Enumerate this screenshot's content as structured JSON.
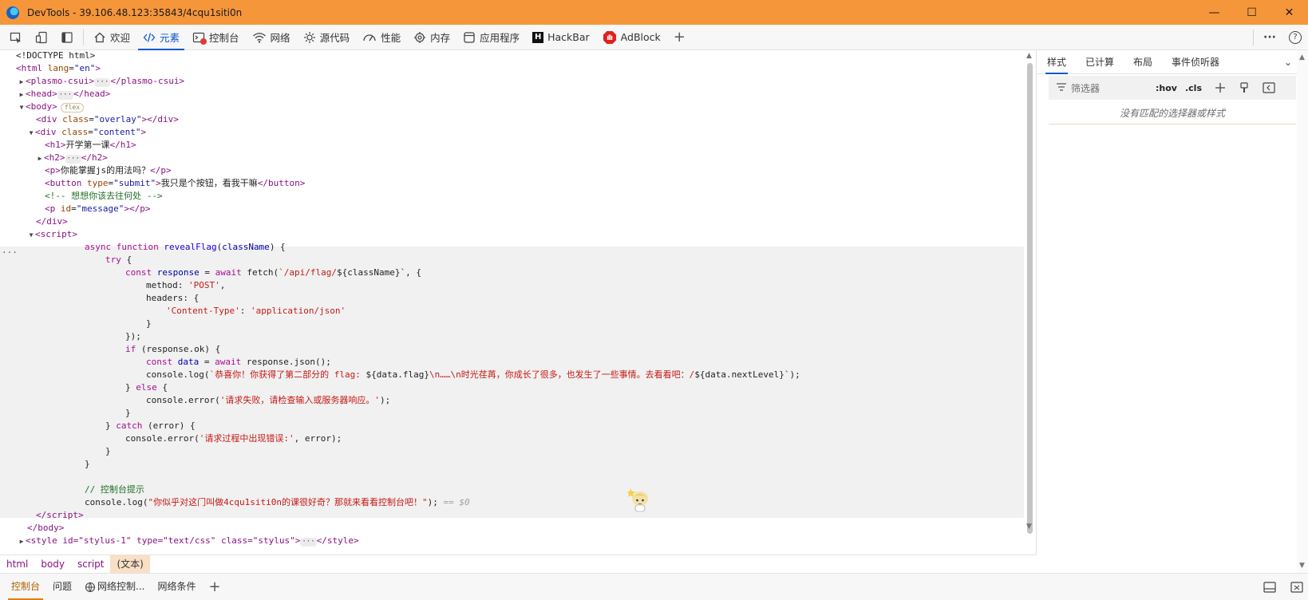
{
  "window": {
    "title": "DevTools - 39.106.48.123:35843/4cqu1siti0n",
    "controls": {
      "minimize": "—",
      "maximize": "☐",
      "close": "✕"
    }
  },
  "toolbar": {
    "tabs": [
      {
        "label": "欢迎",
        "icon": "home-icon"
      },
      {
        "label": "元素",
        "icon": "code-icon",
        "active": true
      },
      {
        "label": "控制台",
        "icon": "console-icon"
      },
      {
        "label": "网络",
        "icon": "wifi-icon"
      },
      {
        "label": "源代码",
        "icon": "gear-source-icon"
      },
      {
        "label": "性能",
        "icon": "performance-icon"
      },
      {
        "label": "内存",
        "icon": "memory-icon"
      },
      {
        "label": "应用程序",
        "icon": "application-icon"
      },
      {
        "label": "HackBar",
        "icon": "hackbar-icon"
      },
      {
        "label": "AdBlock",
        "icon": "adblock-icon"
      }
    ],
    "add_tab": "+",
    "more": "···",
    "help": "?"
  },
  "dom": {
    "doctype": "<!DOCTYPE html>",
    "html_open": "<html",
    "html_lang_attr": "lang",
    "html_lang_val": "\"en\"",
    "plasmo": "plasmo-csui",
    "head": "head",
    "body": "body",
    "flex_badge": "flex",
    "overlay_div_class": "\"overlay\"",
    "content_div_class": "\"content\"",
    "h1_text": "开学第一课",
    "p_text": "你能掌握js的用法吗？",
    "button_type": "\"submit\"",
    "button_text": "我只是个按钮，看我干嘛",
    "comment": "<!-- 想想你该去往何处 -->",
    "message_id": "\"message\"",
    "script": "script",
    "style_partial": "<style id=\"stylus-1\" type=\"text/css\" class=\"stylus\">",
    "ellipsis": "···"
  },
  "script_code": {
    "l1_kw": "async function",
    "l1_fn": "revealFlag",
    "l1_param": "className",
    "l2_kw": "try",
    "l3_const": "const",
    "l3_var": "response",
    "l3_await": "await",
    "l3_fetch": "fetch(",
    "l3_tpl": "`/api/flag/",
    "l3_expr": "${className}",
    "l3_end": "`, {",
    "l4_key": "method:",
    "l4_val": "'POST'",
    "l5_key": "headers: {",
    "l6_key": "'Content-Type'",
    "l6_val": "'application/json'",
    "l9_if": "if",
    "l9_cond": "(response.ok) {",
    "l10_var": "data",
    "l10_rest": "response.json();",
    "l11_call": "console.log(",
    "l11_str1": "`恭喜你！你获得了第二部分的 flag: ",
    "l11_expr1": "${data.flag}",
    "l11_str2": "\\n……\\n时光荏苒，你成长了很多，也发生了一些事情。去看看吧：/",
    "l11_expr2": "${data.nextLevel}",
    "l11_end": "`);",
    "l12_else": "else",
    "l13_call": "console.error(",
    "l13_str": "'请求失败，请检查输入或服务器响应。'",
    "l16_catch": "catch",
    "l16_param": "(error) {",
    "l17_call": "console.error(",
    "l17_str": "'请求过程中出现错误:'",
    "l17_end": ", error);",
    "l21_cmt": "// 控制台提示",
    "l22_call": "console.log(",
    "l22_str": "\"你似乎对这门叫做4cqu1siti0n的课很好奇？那就来看看控制台吧！\"",
    "l22_end": ");",
    "l22_dollar0": "== $0"
  },
  "breadcrumb": [
    "html",
    "body",
    "script",
    "(文本)"
  ],
  "styles_panel": {
    "tabs": [
      "样式",
      "已计算",
      "布局",
      "事件侦听器"
    ],
    "filter_placeholder": "筛选器",
    "hov": ":hov",
    "cls": ".cls",
    "empty_message": "没有匹配的选择器或样式"
  },
  "drawer": {
    "tabs": [
      "控制台",
      "问题",
      "网络控制...",
      "网络条件"
    ],
    "add": "+"
  }
}
